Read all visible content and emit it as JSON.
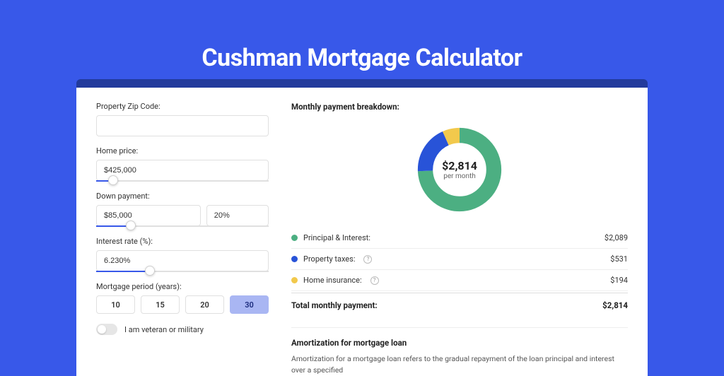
{
  "header": {
    "title": "Cushman Mortgage Calculator"
  },
  "form": {
    "zip": {
      "label": "Property Zip Code:",
      "value": ""
    },
    "price": {
      "label": "Home price:",
      "value": "$425,000",
      "slider_percent": 10
    },
    "down": {
      "label": "Down payment:",
      "amount": "$85,000",
      "percent": "20%",
      "slider_percent": 20
    },
    "rate": {
      "label": "Interest rate (%):",
      "value": "6.230%",
      "slider_percent": 31
    },
    "period": {
      "label": "Mortgage period (years):",
      "options": [
        "10",
        "15",
        "20",
        "30"
      ],
      "selected": "30"
    },
    "veteran": {
      "label": "I am veteran or military",
      "value": false
    }
  },
  "breakdown": {
    "title": "Monthly payment breakdown:",
    "center": {
      "amount": "$2,814",
      "sub": "per month"
    },
    "items": [
      {
        "label": "Principal & Interest:",
        "value": "$2,089",
        "color": "#4caf82"
      },
      {
        "label": "Property taxes:",
        "value": "$531",
        "color": "#2853d8"
      },
      {
        "label": "Home insurance:",
        "value": "$194",
        "color": "#f2c94c"
      }
    ],
    "total": {
      "label": "Total monthly payment:",
      "value": "$2,814"
    }
  },
  "chart_data": {
    "type": "pie",
    "title": "Monthly payment breakdown",
    "categories": [
      "Principal & Interest",
      "Property taxes",
      "Home insurance"
    ],
    "values": [
      2089,
      531,
      194
    ],
    "series": [
      {
        "name": "Principal & Interest",
        "value": 2089,
        "color": "#4caf82"
      },
      {
        "name": "Property taxes",
        "value": 531,
        "color": "#2853d8"
      },
      {
        "name": "Home insurance",
        "value": 194,
        "color": "#f2c94c"
      }
    ],
    "total": 2814,
    "center_label": "$2,814 per month"
  },
  "amortization": {
    "title": "Amortization for mortgage loan",
    "text": "Amortization for a mortgage loan refers to the gradual repayment of the loan principal and interest over a specified"
  }
}
